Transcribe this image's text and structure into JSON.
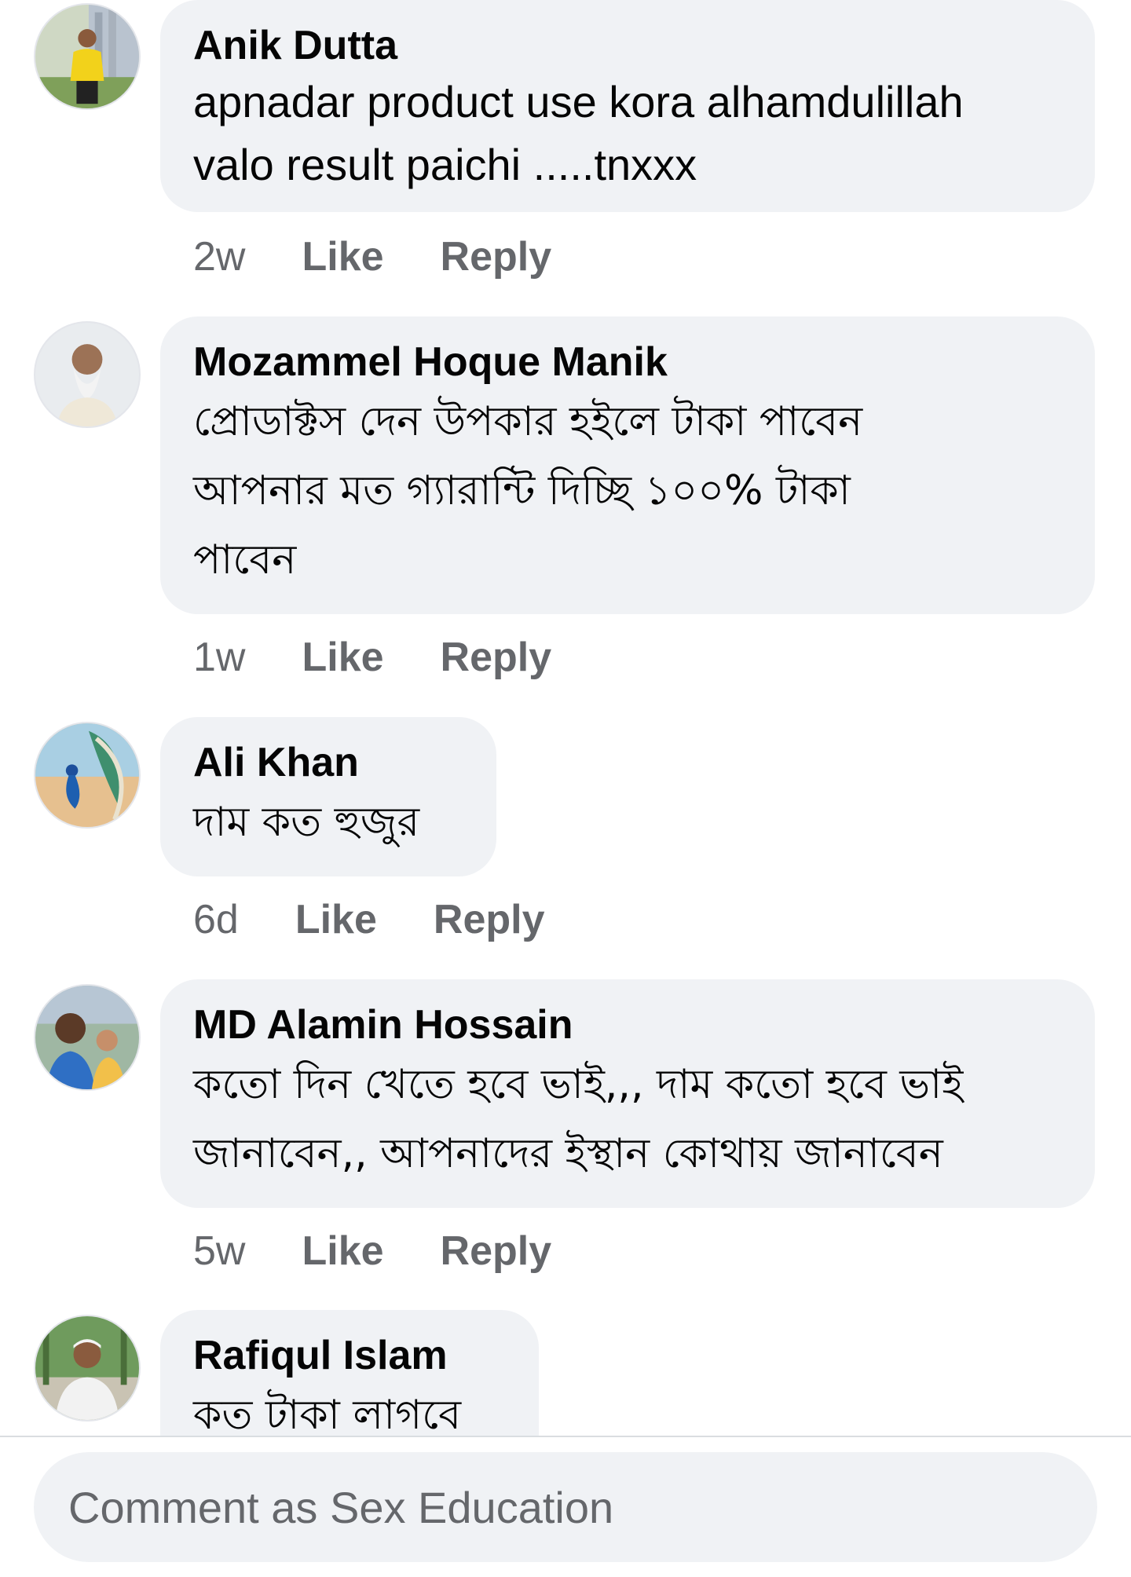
{
  "comments": [
    {
      "author": "Anik Dutta",
      "text": "apnadar product use kora alhamdulillah\nvalo result paichi .....tnxxx",
      "time": "2w",
      "like_label": "Like",
      "reply_label": "Reply"
    },
    {
      "author": "Mozammel Hoque Manik",
      "text": "প্রোডাক্টস দেন উপকার হইলে টাকা পাবেন\nআপনার মত গ্যারান্টি দিচ্ছি ১০০% টাকা\nপাবেন",
      "time": "1w",
      "like_label": "Like",
      "reply_label": "Reply"
    },
    {
      "author": "Ali Khan",
      "text": "দাম কত হুজুর",
      "time": "6d",
      "like_label": "Like",
      "reply_label": "Reply"
    },
    {
      "author": "MD Alamin Hossain",
      "text": "কতো দিন খেতে হবে ভাই,,, দাম কতো হবে ভাই\nজানাবেন,, আপনাদের ইস্থান কোথায় জানাবেন",
      "time": "5w",
      "like_label": "Like",
      "reply_label": "Reply"
    },
    {
      "author": "Rafiqul Islam",
      "text": "কত টাকা লাগবে"
    }
  ],
  "composer": {
    "placeholder": "Comment as Sex Education"
  }
}
